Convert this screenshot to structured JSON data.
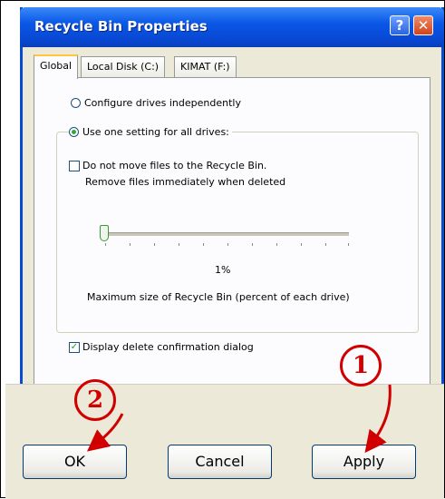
{
  "window": {
    "title": "Recycle Bin Properties"
  },
  "titlebar": {
    "help_glyph": "?",
    "close_glyph": "✕"
  },
  "tabs": [
    {
      "label": "Global"
    },
    {
      "label": "Local Disk (C:)"
    },
    {
      "label": "KIMAT (F:)"
    }
  ],
  "options": {
    "configure_independently": "Configure drives independently",
    "use_one_setting": "Use one setting for all drives:",
    "do_not_move_line1": "Do not move files to the Recycle Bin.",
    "do_not_move_line2": "Remove files immediately when deleted",
    "slider_value": "1%",
    "slider_caption": "Maximum size of Recycle Bin (percent of each drive)",
    "display_confirmation": "Display delete confirmation dialog"
  },
  "buttons": {
    "ok": "OK",
    "cancel": "Cancel",
    "apply": "Apply"
  },
  "annotations": {
    "step1": "1",
    "step2": "2"
  },
  "colors": {
    "title_blue": "#0a57e6",
    "annotation_red": "#d10000"
  }
}
